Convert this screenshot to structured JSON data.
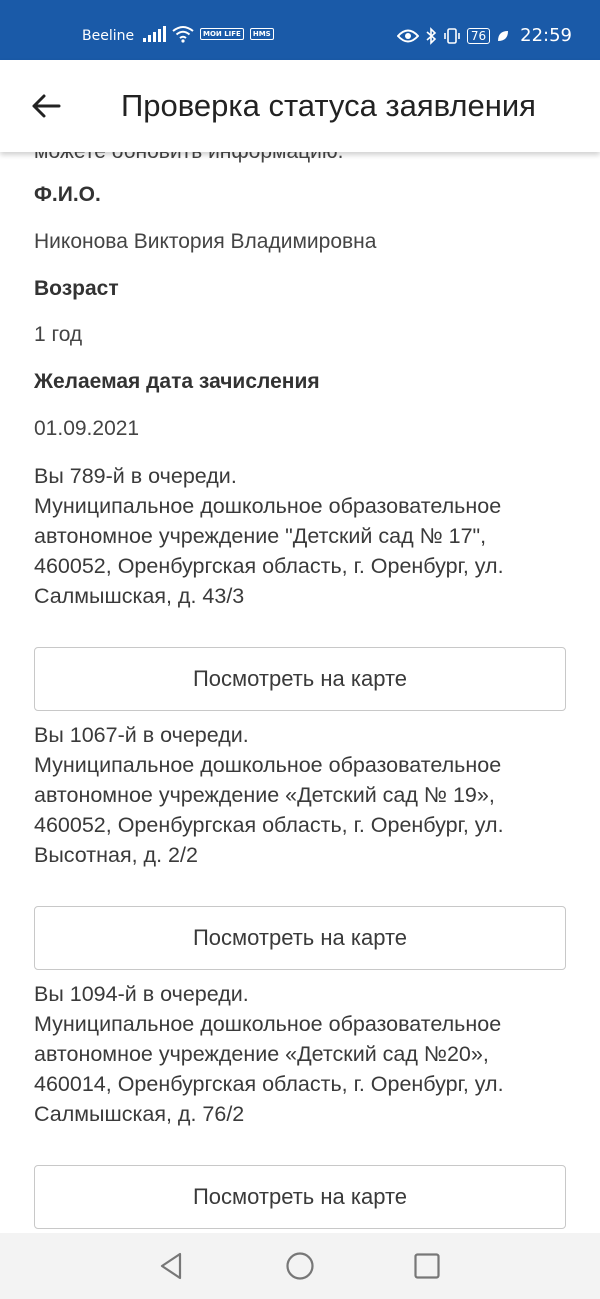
{
  "status_bar": {
    "carrier": "Beeline",
    "badge_1": "МОИ LIFE",
    "badge_2": "HMS",
    "battery": "76",
    "time": "22:59"
  },
  "header": {
    "title": "Проверка статуса заявления"
  },
  "cut_text": "можете обновить информацию.",
  "fields": [
    {
      "label": "Ф.И.О.",
      "value": "Никонова Виктория Владимировна"
    },
    {
      "label": "Возраст",
      "value": "1 год"
    },
    {
      "label": "Желаемая дата зачисления",
      "value": "01.09.2021"
    }
  ],
  "queue": [
    {
      "position": "Вы 789-й в очереди.",
      "lines": [
        "Муниципальное дошкольное образовательное",
        "автономное учреждение \"Детский сад № 17\",",
        "460052, Оренбургская область, г. Оренбург, ул.",
        "Салмышская, д. 43/3"
      ],
      "button": "Посмотреть на карте"
    },
    {
      "position": "Вы 1067-й в очереди.",
      "lines": [
        "Муниципальное дошкольное образовательное",
        "автономное учреждение «Детский сад № 19»,",
        "460052, Оренбургская область, г. Оренбург, ул.",
        "Высотная, д. 2/2"
      ],
      "button": "Посмотреть на карте"
    },
    {
      "position": "Вы 1094-й в очереди.",
      "lines": [
        "Муниципальное дошкольное образовательное",
        "автономное учреждение «Детский сад №20»,",
        "460014, Оренбургская область, г. Оренбург, ул.",
        "Салмышская, д. 76/2"
      ],
      "button": "Посмотреть на карте"
    }
  ],
  "icons": {
    "back": "arrow-left-icon",
    "nav_back": "triangle-back-icon",
    "nav_home": "circle-home-icon",
    "nav_recent": "square-recent-icon"
  },
  "colors": {
    "status_bar": "#1a5aa8",
    "text": "#3c3c3c",
    "button_border": "#c8c8c8"
  }
}
